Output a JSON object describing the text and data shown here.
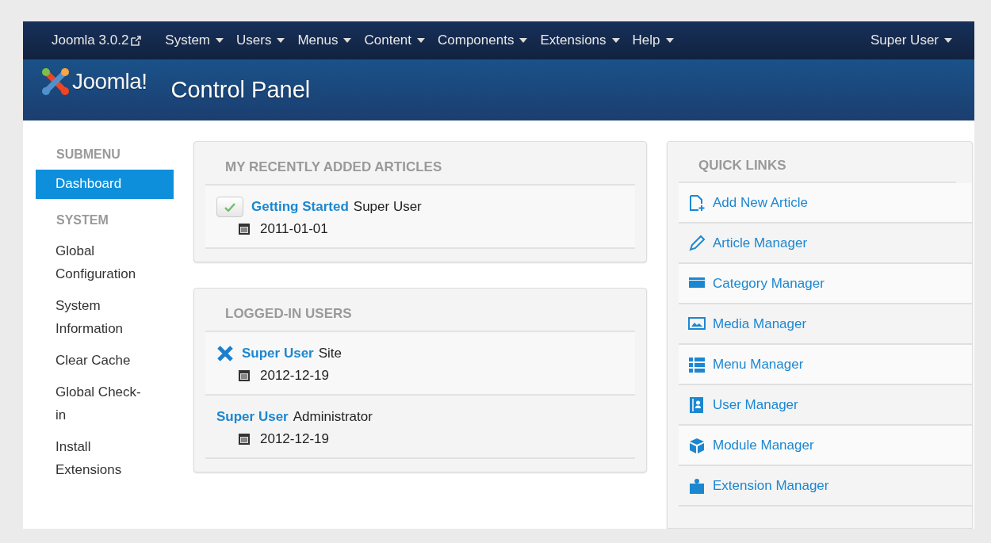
{
  "navbar": {
    "brand": "Joomla 3.0.2",
    "menus": [
      {
        "label": "System"
      },
      {
        "label": "Users"
      },
      {
        "label": "Menus"
      },
      {
        "label": "Content"
      },
      {
        "label": "Components"
      },
      {
        "label": "Extensions"
      },
      {
        "label": "Help"
      }
    ],
    "user_menu": "Super User"
  },
  "header": {
    "logo_text": "Joomla!",
    "title": "Control Panel"
  },
  "sidebar": {
    "sections": [
      {
        "heading": "SUBMENU",
        "items": [
          {
            "label": "Dashboard",
            "selected": true
          }
        ]
      },
      {
        "heading": "SYSTEM",
        "items": [
          {
            "label": "Global Configuration",
            "selected": false
          },
          {
            "label": "System Information",
            "selected": false
          },
          {
            "label": "Clear Cache",
            "selected": false
          },
          {
            "label": "Global Check-in",
            "selected": false
          },
          {
            "label": "Install Extensions",
            "selected": false
          }
        ]
      }
    ]
  },
  "modules": [
    {
      "title": "MY RECENTLY ADDED ARTICLES",
      "rows": [
        {
          "kind": "published",
          "link": "Getting Started",
          "text": "Super User",
          "date": "2011-01-01"
        }
      ]
    },
    {
      "title": "LOGGED-IN USERS",
      "rows": [
        {
          "kind": "logout",
          "link": "Super User",
          "text": "Site",
          "date": "2012-12-19"
        },
        {
          "kind": "plain",
          "link": "Super User",
          "text": "Administrator",
          "date": "2012-12-19"
        }
      ]
    }
  ],
  "quick_links": {
    "title": "QUICK LINKS",
    "items": [
      {
        "label": "Add New Article",
        "kind": "document"
      },
      {
        "label": "Article Manager",
        "kind": "pencil"
      },
      {
        "label": "Category Manager",
        "kind": "folder"
      },
      {
        "label": "Media Manager",
        "kind": "image"
      },
      {
        "label": "Menu Manager",
        "kind": "list"
      },
      {
        "label": "User Manager",
        "kind": "user"
      },
      {
        "label": "Module Manager",
        "kind": "cube"
      },
      {
        "label": "Extension Manager",
        "kind": "puzzle"
      }
    ]
  }
}
